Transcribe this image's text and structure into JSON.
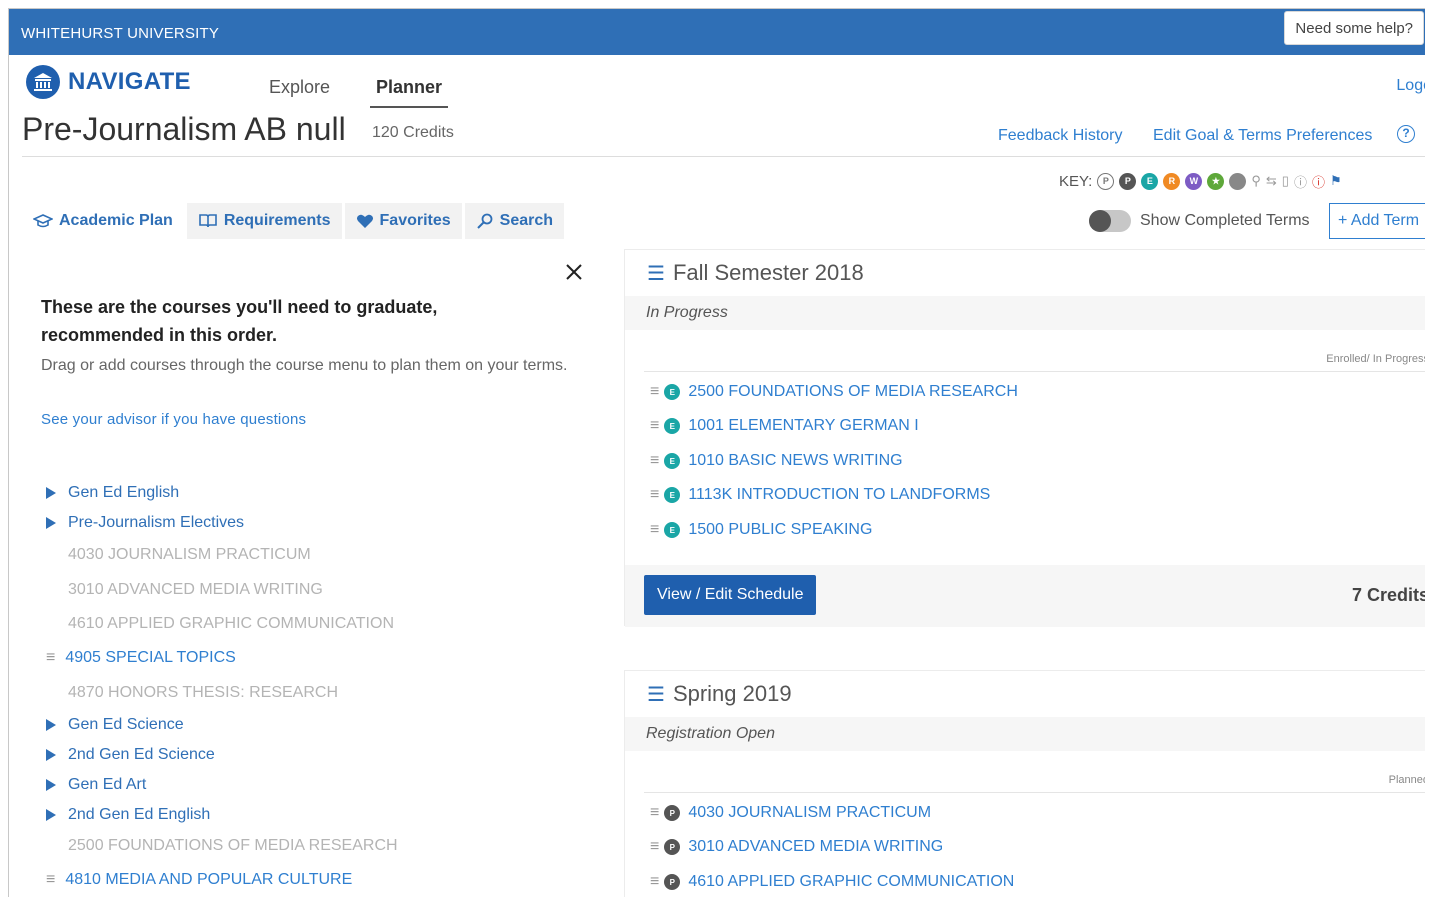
{
  "topbar": {
    "university": "WHITEHURST UNIVERSITY",
    "help": "Need some help?"
  },
  "nav": {
    "brand": "NAVIGATE",
    "tabs": [
      {
        "label": "Explore"
      },
      {
        "label": "Planner"
      }
    ],
    "logout": "Logo"
  },
  "page": {
    "title": "Pre-Journalism AB null",
    "credits": "120 Credits",
    "feedback": "Feedback History",
    "edit_goal": "Edit Goal & Terms Preferences",
    "help_icon": "?"
  },
  "key": {
    "label": "KEY:",
    "badges": [
      "P",
      "P",
      "E",
      "R",
      "W"
    ]
  },
  "tabs": [
    {
      "label": "Academic Plan",
      "icon": "graduation-cap-icon"
    },
    {
      "label": "Requirements",
      "icon": "book-icon"
    },
    {
      "label": "Favorites",
      "icon": "heart-icon"
    },
    {
      "label": "Search",
      "icon": "search-icon"
    }
  ],
  "terms_controls": {
    "show_completed": "Show Completed Terms",
    "add_term": "+ Add Term"
  },
  "left": {
    "heading": "These are the courses you'll need to graduate, recommended in this order.",
    "sub": "Drag or add courses through the course menu to plan them on your terms.",
    "advisor": "See your advisor if you have questions",
    "items": [
      {
        "label": "Gen Ed English",
        "kind": "group"
      },
      {
        "label": "Pre-Journalism Electives",
        "kind": "group"
      },
      {
        "label": "4030 JOURNALISM PRACTICUM",
        "kind": "grey"
      },
      {
        "label": "3010 ADVANCED MEDIA WRITING",
        "kind": "grey"
      },
      {
        "label": "4610 APPLIED GRAPHIC COMMUNICATION",
        "kind": "grey"
      },
      {
        "label": "4905 SPECIAL TOPICS",
        "kind": "link"
      },
      {
        "label": "4870 HONORS THESIS: RESEARCH",
        "kind": "grey"
      },
      {
        "label": "Gen Ed Science",
        "kind": "group"
      },
      {
        "label": "2nd Gen Ed Science",
        "kind": "group"
      },
      {
        "label": "Gen Ed Art",
        "kind": "group"
      },
      {
        "label": "2nd Gen Ed English",
        "kind": "group"
      },
      {
        "label": "2500 FOUNDATIONS OF MEDIA RESEARCH",
        "kind": "grey"
      },
      {
        "label": "4810 MEDIA AND POPULAR CULTURE",
        "kind": "link"
      }
    ]
  },
  "terms": [
    {
      "name": "Fall Semester 2018",
      "status": "In Progress",
      "label": "Enrolled/ In Progress",
      "badge": "E",
      "badge_color": "#1aa6a6",
      "courses": [
        "2500 FOUNDATIONS OF MEDIA RESEARCH",
        "1001 ELEMENTARY GERMAN I",
        "1010 BASIC NEWS WRITING",
        "1113K INTRODUCTION TO LANDFORMS",
        "1500 PUBLIC SPEAKING"
      ],
      "button": "View / Edit Schedule",
      "credits": "7 Credits"
    },
    {
      "name": "Spring 2019",
      "status": "Registration Open",
      "label": "Planned",
      "badge": "P",
      "badge_color": "#555555",
      "courses": [
        "4030 JOURNALISM PRACTICUM",
        "3010 ADVANCED MEDIA WRITING",
        "4610 APPLIED GRAPHIC COMMUNICATION"
      ]
    }
  ],
  "colors": {
    "topbar": "#2f6fb6",
    "link": "#2f7fd0",
    "button": "#1f5fae"
  }
}
